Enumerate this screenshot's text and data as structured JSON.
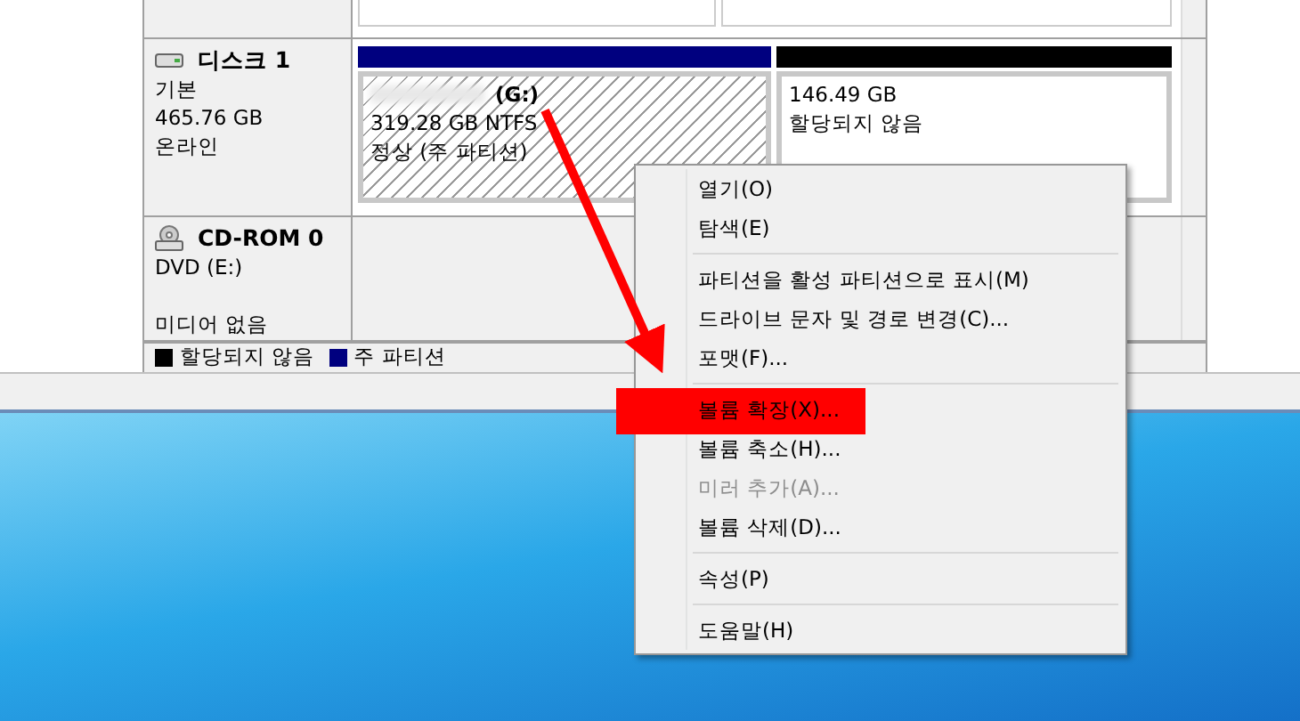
{
  "disks": [
    {
      "kind": "disk",
      "name": "디스크 1",
      "lines": [
        "기본",
        "465.76 GB",
        "온라인"
      ],
      "partitions": [
        {
          "kind": "primary",
          "selected": true,
          "label": "(G:)",
          "lines": [
            "319.28 GB NTFS",
            "정상 (주 파티션)"
          ]
        },
        {
          "kind": "unallocated",
          "selected": false,
          "lines": [
            "146.49 GB",
            "할당되지 않음"
          ]
        }
      ]
    },
    {
      "kind": "cdrom",
      "name": "CD-ROM 0",
      "lines": [
        "DVD (E:)"
      ],
      "status": "미디어 없음"
    }
  ],
  "legend": [
    {
      "label": "할당되지 않음",
      "color": "#000000"
    },
    {
      "label": "주 파티션",
      "color": "#00007f"
    }
  ],
  "menu": [
    [
      {
        "label": "열기(O)",
        "disabled": false,
        "marked": false
      },
      {
        "label": "탐색(E)",
        "disabled": false,
        "marked": false
      }
    ],
    [
      {
        "label": "파티션을 활성 파티션으로 표시(M)",
        "disabled": false,
        "marked": false
      },
      {
        "label": "드라이브 문자 및 경로 변경(C)...",
        "disabled": false,
        "marked": false
      },
      {
        "label": "포맷(F)...",
        "disabled": false,
        "marked": false
      }
    ],
    [
      {
        "label": "볼륨 확장(X)...",
        "disabled": false,
        "marked": true
      },
      {
        "label": "볼륨 축소(H)...",
        "disabled": false,
        "marked": false
      },
      {
        "label": "미러 추가(A)...",
        "disabled": true,
        "marked": false
      },
      {
        "label": "볼륨 삭제(D)...",
        "disabled": false,
        "marked": false
      }
    ],
    [
      {
        "label": "속성(P)",
        "disabled": false,
        "marked": false
      }
    ],
    [
      {
        "label": "도움말(H)",
        "disabled": false,
        "marked": false
      }
    ]
  ]
}
